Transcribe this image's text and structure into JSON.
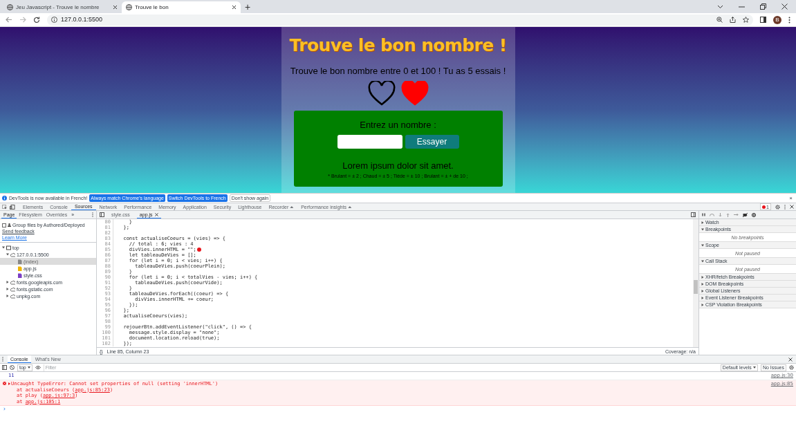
{
  "browser": {
    "tabs": [
      {
        "title": "Jeu Javascript - Trouve le nombre",
        "selected": false
      },
      {
        "title": "Trouve le bon",
        "selected": true
      }
    ],
    "new_tab": "+",
    "address": "127.0.0.1:5500",
    "profile": "B"
  },
  "page": {
    "title": "Trouve le bon nombre !",
    "subtitle": "Trouve le bon nombre entre 0 et 100 ! Tu as 5 essais !",
    "hearts": [
      {
        "filled": false
      },
      {
        "filled": true
      }
    ],
    "prompt": "Entrez un nombre :",
    "button": "Essayer",
    "message": "Lorem ipsum dolor sit amet.",
    "hint": "* Brulant = ± 2 ; Chaud = ± 5 ; Tiède = ± 10 ; Brulant = ± + de 10 ;"
  },
  "infobar": {
    "text": "DevTools is now available in French!",
    "buttons": [
      "Always match Chrome's language",
      "Switch DevTools to French"
    ],
    "dismiss": "Don't show again",
    "close": "×"
  },
  "devtools": {
    "tabs": [
      {
        "label": "Elements",
        "selected": false
      },
      {
        "label": "Console",
        "selected": false
      },
      {
        "label": "Sources",
        "selected": true
      },
      {
        "label": "Network",
        "selected": false
      },
      {
        "label": "Performance",
        "selected": false
      },
      {
        "label": "Memory",
        "selected": false
      },
      {
        "label": "Application",
        "selected": false
      },
      {
        "label": "Security",
        "selected": false
      },
      {
        "label": "Lighthouse",
        "selected": false
      },
      {
        "label": "Recorder ⏶",
        "selected": false
      },
      {
        "label": "Performance insights ⏶",
        "selected": false
      }
    ],
    "error_count": "1",
    "navigator": {
      "tabs": [
        {
          "label": "Page",
          "selected": true
        },
        {
          "label": "Filesystem",
          "selected": false
        },
        {
          "label": "Overrides",
          "selected": false
        }
      ],
      "more": "»",
      "group_option": "Group files by Authored/Deployed",
      "group_checked": false,
      "links": [
        "Send feedback",
        "Learn More"
      ],
      "tree": [
        {
          "label": "top",
          "kind": "frame",
          "expanded": true,
          "children": [
            {
              "label": "127.0.0.1:5500",
              "kind": "origin",
              "expanded": true,
              "children": [
                {
                  "label": "(index)",
                  "kind": "html",
                  "selected": true
                },
                {
                  "label": "app.js",
                  "kind": "js",
                  "selected": false
                },
                {
                  "label": "style.css",
                  "kind": "css",
                  "selected": false
                }
              ]
            },
            {
              "label": "fonts.googleapis.com",
              "kind": "origin",
              "expanded": false
            },
            {
              "label": "fonts.gstatic.com",
              "kind": "origin",
              "expanded": false
            },
            {
              "label": "unpkg.com",
              "kind": "origin",
              "expanded": false
            }
          ]
        }
      ]
    },
    "pretty_print": "{}",
    "editor_tabs": [
      {
        "label": "style.css",
        "selected": false
      },
      {
        "label": "app.js",
        "selected": true
      }
    ],
    "code": [
      {
        "n": "80",
        "text": "    }"
      },
      {
        "n": "81",
        "text": "  };"
      },
      {
        "n": "82"
      },
      {
        "n": "83",
        "text": "  const actualiseCoeurs = (vies) => {"
      },
      {
        "n": "84",
        "text": "    // total : 6; vies : 4"
      },
      {
        "n": "85",
        "text": "    divVies.innerHTML = \"\";",
        "error": true
      },
      {
        "n": "86",
        "text": "    let tableauDeVies = [];"
      },
      {
        "n": "87",
        "text": "    for (let i = 0; i < vies; i++) {"
      },
      {
        "n": "88",
        "text": "      tableauDeVies.push(coeurPlein);"
      },
      {
        "n": "89",
        "text": "    }"
      },
      {
        "n": "90",
        "text": "    for (let i = 0; i < totalVies - vies; i++) {"
      },
      {
        "n": "91",
        "text": "      tableauDeVies.push(coeurVide);"
      },
      {
        "n": "92",
        "text": "    }"
      },
      {
        "n": "93",
        "text": "    tableauDeVies.forEach((coeur) => {"
      },
      {
        "n": "94",
        "text": "      divVies.innerHTML += coeur;"
      },
      {
        "n": "95",
        "text": "    });"
      },
      {
        "n": "96",
        "text": "  };"
      },
      {
        "n": "97",
        "text": "  actualiseCoeurs(vies);"
      },
      {
        "n": "98"
      },
      {
        "n": "99",
        "text": "  rejouerBtn.addEventListener(\"click\", () => {"
      },
      {
        "n": "100",
        "text": "    message.style.display = \"none\";"
      },
      {
        "n": "101",
        "text": "    document.location.reload(true);"
      },
      {
        "n": "102",
        "text": "  });"
      }
    ],
    "cursor": "Line 85, Column 23",
    "coverage": "Coverage: n/a",
    "debugger": [
      {
        "label": "Watch",
        "expanded": false
      },
      {
        "label": "Breakpoints",
        "expanded": true,
        "body": "No breakpoints"
      },
      {
        "label": "Scope",
        "expanded": true,
        "body": "Not paused"
      },
      {
        "label": "Call Stack",
        "expanded": true,
        "body": "Not paused"
      },
      {
        "label": "XHR/fetch Breakpoints",
        "expanded": false
      },
      {
        "label": "DOM Breakpoints",
        "expanded": false
      },
      {
        "label": "Global Listeners",
        "expanded": false
      },
      {
        "label": "Event Listener Breakpoints",
        "expanded": false
      },
      {
        "label": "CSP Violation Breakpoints",
        "expanded": false
      }
    ],
    "drawer": {
      "tabs": [
        {
          "label": "Console",
          "selected": true
        },
        {
          "label": "What's New",
          "selected": false
        }
      ],
      "context": "top",
      "filter_placeholder": "Filter",
      "levels": "Default levels",
      "issues": "No Issues",
      "messages": [
        {
          "kind": "log",
          "text": "11",
          "source": "app.js:30"
        },
        {
          "kind": "error",
          "text": "Uncaught TypeError: Cannot set properties of null (setting 'innerHTML')",
          "source": "app.js:85",
          "stack": [
            {
              "fn": "at actualiseCoeurs (",
              "loc": "app.js:85:23",
              "end": ")"
            },
            {
              "fn": "at play (",
              "loc": "app.js:97:3",
              "end": ")"
            },
            {
              "fn": "at ",
              "loc": "app.js:105:1"
            }
          ]
        }
      ],
      "prompt": "›"
    }
  }
}
